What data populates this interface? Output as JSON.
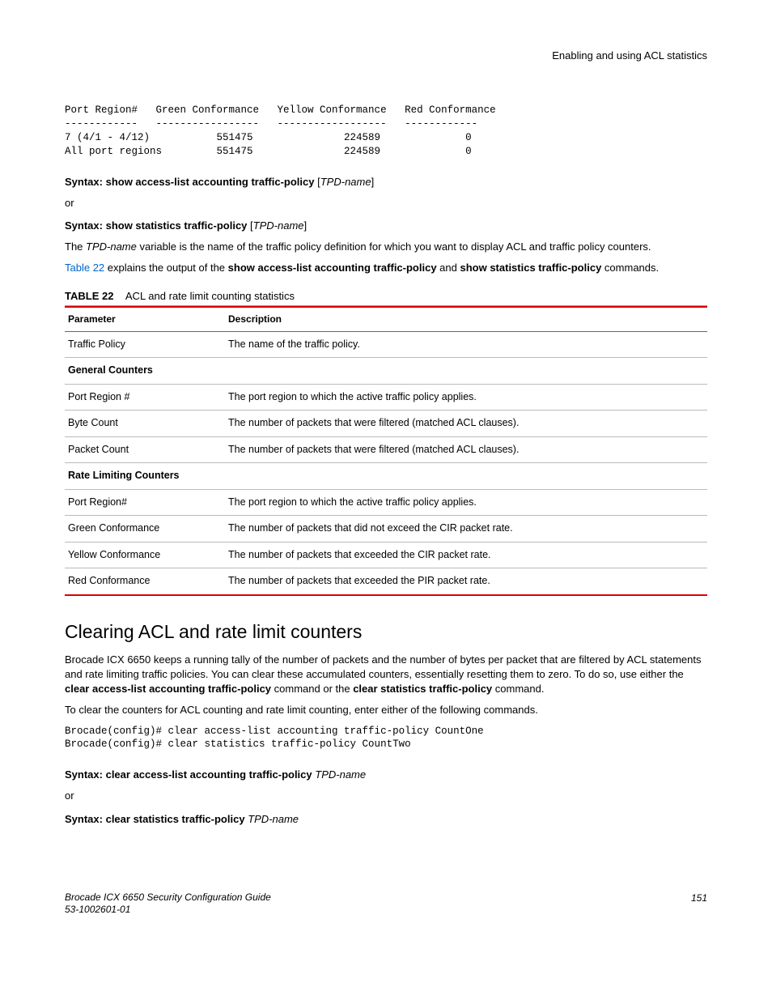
{
  "header": {
    "title": "Enabling and using ACL statistics"
  },
  "codeBlock1": "Port Region#   Green Conformance   Yellow Conformance   Red Conformance\n------------   -----------------   ------------------   ------------\n7 (4/1 - 4/12)           551475               224589              0\nAll port regions         551475               224589              0",
  "syntax1": {
    "label": "Syntax:",
    "cmd": "show access-list accounting traffic-policy",
    "arg": "TPD-name"
  },
  "or1": "or",
  "syntax2": {
    "label": "Syntax:",
    "cmd": "show statistics traffic-policy",
    "arg": "TPD-name"
  },
  "para1": {
    "pre": "The ",
    "italic": "TPD-name",
    "post": " variable is the name of the traffic policy definition for which you want to display ACL and traffic policy counters."
  },
  "para2": {
    "link": "Table 22",
    "mid": " explains the output of the ",
    "b1": "show access-list accounting traffic-policy",
    "and": " and ",
    "b2": "show statistics traffic-policy",
    "tail": " commands."
  },
  "tableCaption": {
    "num": "TABLE 22",
    "title": "ACL and rate limit counting statistics"
  },
  "tableHeaders": {
    "param": "Parameter",
    "desc": "Description"
  },
  "tableRows": [
    {
      "param": "Traffic Policy",
      "desc": "The name of the traffic policy.",
      "section": false
    },
    {
      "param": "General Counters",
      "desc": "",
      "section": true
    },
    {
      "param": "Port Region #",
      "desc": "The port region to which the active traffic policy applies.",
      "section": false
    },
    {
      "param": "Byte Count",
      "desc": "The number of packets that were filtered (matched ACL clauses).",
      "section": false
    },
    {
      "param": "Packet Count",
      "desc": "The number of packets that were filtered (matched ACL clauses).",
      "section": false
    },
    {
      "param": "Rate Limiting Counters",
      "desc": "",
      "section": true
    },
    {
      "param": "Port Region#",
      "desc": "The port region to which the active traffic policy applies.",
      "section": false
    },
    {
      "param": "Green Conformance",
      "desc": "The number of packets that did not exceed the CIR packet rate.",
      "section": false
    },
    {
      "param": "Yellow Conformance",
      "desc": "The number of packets that exceeded the CIR packet rate.",
      "section": false
    },
    {
      "param": "Red Conformance",
      "desc": "The number of packets that exceeded the PIR packet rate.",
      "section": false
    }
  ],
  "h2": "Clearing ACL and rate limit counters",
  "para3": {
    "t1": "Brocade ICX 6650 keeps a running tally of the number of packets and the number of bytes per packet that are filtered by ACL statements and rate limiting traffic policies. You can clear these accumulated counters, essentially resetting them to zero. To do so, use either the ",
    "b1": "clear access-list accounting traffic-policy",
    "t2": " command or the ",
    "b2": "clear statistics traffic-policy",
    "t3": " command."
  },
  "para4": "To clear the counters for ACL counting and rate limit counting, enter either of the following commands.",
  "codeBlock2": "Brocade(config)# clear access-list accounting traffic-policy CountOne\nBrocade(config)# clear statistics traffic-policy CountTwo",
  "syntax3": {
    "label": "Syntax:",
    "cmd": "clear access-list accounting traffic-policy",
    "arg": "TPD-name"
  },
  "or3": "or",
  "syntax4": {
    "label": "Syntax:",
    "cmd": "clear statistics traffic-policy",
    "arg": "TPD-name"
  },
  "footer": {
    "line1": "Brocade ICX 6650 Security Configuration Guide",
    "line2": "53-1002601-01",
    "page": "151"
  }
}
